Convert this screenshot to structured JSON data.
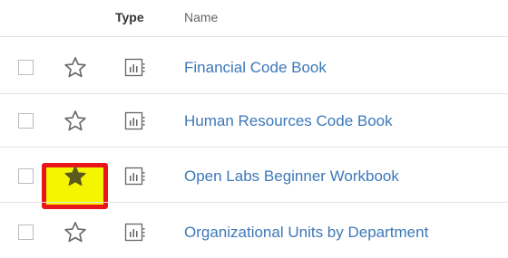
{
  "header": {
    "type_label": "Type",
    "name_label": "Name"
  },
  "rows": [
    {
      "name": "Financial Code Book",
      "favorite": false,
      "type_icon": "workbook-icon"
    },
    {
      "name": "Human Resources Code Book",
      "favorite": false,
      "type_icon": "workbook-icon"
    },
    {
      "name": "Open Labs Beginner Workbook",
      "favorite": true,
      "type_icon": "workbook-icon"
    },
    {
      "name": "Organizational Units by Department",
      "favorite": false,
      "type_icon": "workbook-icon"
    }
  ],
  "colors": {
    "link": "#3d78b8",
    "highlight_fill": "#f6f500",
    "highlight_border": "#e8151b",
    "star_outline": "#666666",
    "star_filled": "#5a5a1e"
  }
}
